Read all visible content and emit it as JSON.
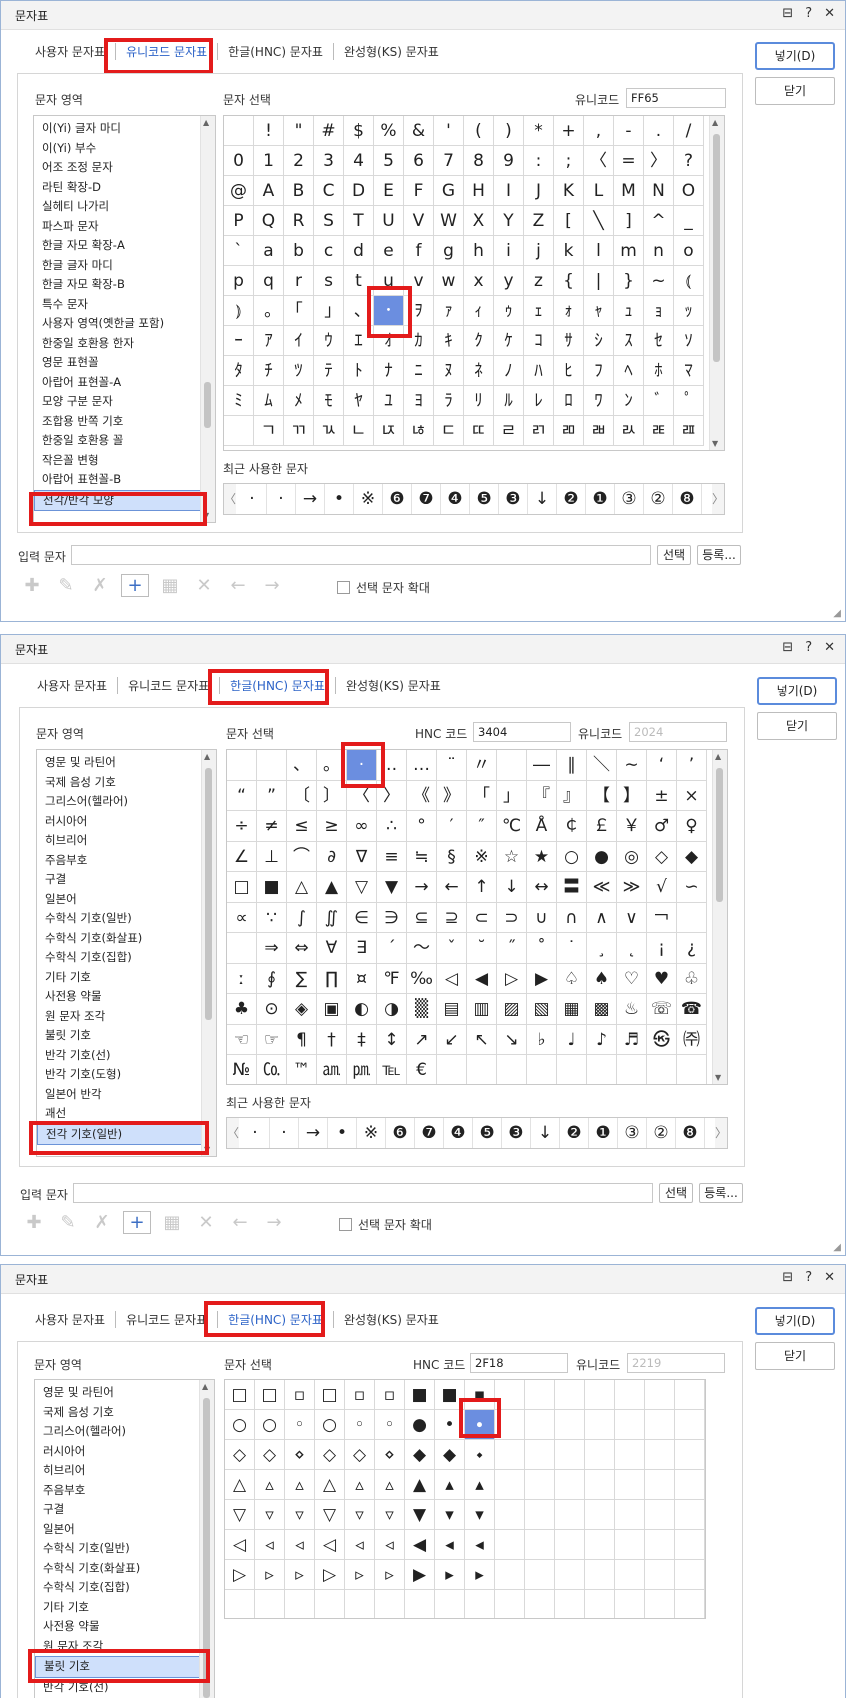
{
  "dialog1": {
    "title": "문자표",
    "tabs": [
      "사용자 문자표",
      "유니코드 문자표",
      "한글(HNC) 문자표",
      "완성형(KS) 문자표"
    ],
    "active_tab": 1,
    "area_label": "문자 영역",
    "select_label": "문자 선택",
    "code_label": "유니코드",
    "code_value": "FF65",
    "list": [
      "이(Yi) 글자 마디",
      "이(Yi) 부수",
      "어조 조정 문자",
      "라틴 확장-D",
      "실헤티 나가리",
      "파스파 문자",
      "한글 자모 확장-A",
      "한글 글자 마디",
      "한글 자모 확장-B",
      "특수 문자",
      "사용자 영역(옛한글 포함)",
      "한중일 호환용 한자",
      "영문 표현꼴",
      "아랍어 표현꼴-A",
      "모양 구분 문자",
      "조합용 반쪽 기호",
      "한중일 호환용 꼴",
      "작은꼴 변형",
      "아랍어 표현꼴-B",
      "전각/반각 모양"
    ],
    "list_selected": 19,
    "grid": [
      [
        "",
        "!",
        "\"",
        "#",
        "$",
        "%",
        "&",
        "'",
        "(",
        ")",
        "*",
        "+",
        ",",
        "-",
        ".",
        "/"
      ],
      [
        "0",
        "1",
        "2",
        "3",
        "4",
        "5",
        "6",
        "7",
        "8",
        "9",
        ":",
        ";",
        "〈",
        "=",
        "〉",
        "?"
      ],
      [
        "@",
        "A",
        "B",
        "C",
        "D",
        "E",
        "F",
        "G",
        "H",
        "I",
        "J",
        "K",
        "L",
        "M",
        "N",
        "O"
      ],
      [
        "P",
        "Q",
        "R",
        "S",
        "T",
        "U",
        "V",
        "W",
        "X",
        "Y",
        "Z",
        "[",
        "╲",
        "]",
        "^",
        "_"
      ],
      [
        "`",
        "a",
        "b",
        "c",
        "d",
        "e",
        "f",
        "g",
        "h",
        "i",
        "j",
        "k",
        "l",
        "m",
        "n",
        "o"
      ],
      [
        "p",
        "q",
        "r",
        "s",
        "t",
        "u",
        "v",
        "w",
        "x",
        "y",
        "z",
        "{",
        "|",
        "}",
        "~",
        "⦅"
      ],
      [
        "⦆",
        "｡",
        "｢",
        "｣",
        "､",
        "･",
        "ｦ",
        "ｧ",
        "ｨ",
        "ｩ",
        "ｪ",
        "ｫ",
        "ｬ",
        "ｭ",
        "ｮ",
        "ｯ"
      ],
      [
        "ｰ",
        "ｱ",
        "ｲ",
        "ｳ",
        "ｴ",
        "ｵ",
        "ｶ",
        "ｷ",
        "ｸ",
        "ｹ",
        "ｺ",
        "ｻ",
        "ｼ",
        "ｽ",
        "ｾ",
        "ｿ"
      ],
      [
        "ﾀ",
        "ﾁ",
        "ﾂ",
        "ﾃ",
        "ﾄ",
        "ﾅ",
        "ﾆ",
        "ﾇ",
        "ﾈ",
        "ﾉ",
        "ﾊ",
        "ﾋ",
        "ﾌ",
        "ﾍ",
        "ﾎ",
        "ﾏ"
      ],
      [
        "ﾐ",
        "ﾑ",
        "ﾒ",
        "ﾓ",
        "ﾔ",
        "ﾕ",
        "ﾖ",
        "ﾗ",
        "ﾘ",
        "ﾙ",
        "ﾚ",
        "ﾛ",
        "ﾜ",
        "ﾝ",
        "ﾞ",
        "ﾟ"
      ],
      [
        "",
        "ﾡ",
        "ﾢ",
        "ﾣ",
        "ﾤ",
        "ﾥ",
        "ﾦ",
        "ﾧ",
        "ﾨ",
        "ﾩ",
        "ﾪ",
        "ﾫ",
        "ﾬ",
        "ﾭ",
        "ﾮ",
        "ﾯ"
      ]
    ],
    "selected_cell": [
      6,
      5
    ],
    "recent_label": "최근 사용한 문자",
    "recent": [
      "·",
      "·",
      "→",
      "•",
      "※",
      "❻",
      "❼",
      "❹",
      "❺",
      "❸",
      "↓",
      "❷",
      "❶",
      "③",
      "②",
      "❽"
    ],
    "input_label": "입력 문자",
    "input_value": "",
    "select_btn": "선택",
    "register_btn": "등록...",
    "enlarge_label": "선택 문자 확대",
    "insert_btn": "넣기(D)",
    "close_btn": "닫기"
  },
  "dialog2": {
    "title": "문자표",
    "tabs": [
      "사용자 문자표",
      "유니코드 문자표",
      "한글(HNC) 문자표",
      "완성형(KS) 문자표"
    ],
    "active_tab": 2,
    "area_label": "문자 영역",
    "select_label": "문자 선택",
    "hnc_label": "HNC 코드",
    "hnc_value": "3404",
    "code_label": "유니코드",
    "code_value": "2024",
    "list": [
      "영문 및 라틴어",
      "국제 음성 기호",
      "그리스어(헬라어)",
      "러시아어",
      "히브리어",
      "주음부호",
      "구결",
      "일본어",
      "수학식 기호(일반)",
      "수학식 기호(화살표)",
      "수학식 기호(집합)",
      "기타 기호",
      "사전용 약물",
      "원 문자 조각",
      "불릿 기호",
      "반각 기호(선)",
      "반각 기호(도형)",
      "일본어 반각",
      "괘선",
      "전각 기호(일반)"
    ],
    "list_selected": 19,
    "grid": [
      [
        "",
        "",
        "、",
        "。",
        "·",
        "‥",
        "…",
        "¨",
        "〃",
        "­",
        "―",
        "∥",
        "＼",
        "∼",
        "‘",
        "’"
      ],
      [
        "“",
        "”",
        "〔",
        "〕",
        "〈",
        "〉",
        "《",
        "》",
        "「",
        "」",
        "『",
        "』",
        "【",
        "】",
        "±",
        "×"
      ],
      [
        "÷",
        "≠",
        "≤",
        "≥",
        "∞",
        "∴",
        "°",
        "′",
        "″",
        "℃",
        "Å",
        "￠",
        "￡",
        "￥",
        "♂",
        "♀"
      ],
      [
        "∠",
        "⊥",
        "⌒",
        "∂",
        "∇",
        "≡",
        "≒",
        "§",
        "※",
        "☆",
        "★",
        "○",
        "●",
        "◎",
        "◇",
        "◆"
      ],
      [
        "□",
        "■",
        "△",
        "▲",
        "▽",
        "▼",
        "→",
        "←",
        "↑",
        "↓",
        "↔",
        "〓",
        "≪",
        "≫",
        "√",
        "∽"
      ],
      [
        "∝",
        "∵",
        "∫",
        "∬",
        "∈",
        "∋",
        "⊆",
        "⊇",
        "⊂",
        "⊃",
        "∪",
        "∩",
        "∧",
        "∨",
        "￢",
        ""
      ],
      [
        "",
        "⇒",
        "⇔",
        "∀",
        "∃",
        "´",
        "～",
        "ˇ",
        "˘",
        "˝",
        "˚",
        "˙",
        "¸",
        "˛",
        "¡",
        "¿"
      ],
      [
        "ː",
        "∮",
        "∑",
        "∏",
        "¤",
        "℉",
        "‰",
        "◁",
        "◀",
        "▷",
        "▶",
        "♤",
        "♠",
        "♡",
        "♥",
        "♧"
      ],
      [
        "♣",
        "⊙",
        "◈",
        "▣",
        "◐",
        "◑",
        "▒",
        "▤",
        "▥",
        "▨",
        "▧",
        "▦",
        "▩",
        "♨",
        "☏",
        "☎"
      ],
      [
        "☜",
        "☞",
        "¶",
        "†",
        "‡",
        "↕",
        "↗",
        "↙",
        "↖",
        "↘",
        "♭",
        "♩",
        "♪",
        "♬",
        "㉿",
        "㈜"
      ],
      [
        "№",
        "㏇",
        "™",
        "㏂",
        "㏘",
        "℡",
        "€",
        "",
        "",
        "",
        "",
        "",
        "",
        "",
        "",
        ""
      ]
    ],
    "selected_cell": [
      0,
      4
    ],
    "recent_label": "최근 사용한 문자",
    "recent": [
      "·",
      "·",
      "→",
      "•",
      "※",
      "❻",
      "❼",
      "❹",
      "❺",
      "❸",
      "↓",
      "❷",
      "❶",
      "③",
      "②",
      "❽"
    ],
    "input_label": "입력 문자",
    "input_value": "",
    "select_btn": "선택",
    "register_btn": "등록...",
    "enlarge_label": "선택 문자 확대",
    "insert_btn": "넣기(D)",
    "close_btn": "닫기"
  },
  "dialog3": {
    "title": "문자표",
    "tabs": [
      "사용자 문자표",
      "유니코드 문자표",
      "한글(HNC) 문자표",
      "완성형(KS) 문자표"
    ],
    "active_tab": 2,
    "area_label": "문자 영역",
    "select_label": "문자 선택",
    "hnc_label": "HNC 코드",
    "hnc_value": "2F18",
    "code_label": "유니코드",
    "code_value": "2219",
    "list": [
      "영문 및 라틴어",
      "국제 음성 기호",
      "그리스어(헬라어)",
      "러시아어",
      "히브리어",
      "주음부호",
      "구결",
      "일본어",
      "수학식 기호(일반)",
      "수학식 기호(화살표)",
      "수학식 기호(집합)",
      "기타 기호",
      "사전용 약물",
      "원 문자 조각",
      "불릿 기호",
      "반각 기호(선)"
    ],
    "list_selected": 14,
    "grid": [
      [
        "□",
        "□",
        "▫",
        "□",
        "▫",
        "▫",
        "■",
        "■",
        "▪",
        "",
        "",
        "",
        "",
        "",
        "",
        ""
      ],
      [
        "○",
        "○",
        "◦",
        "○",
        "◦",
        "◦",
        "●",
        "•",
        "∙",
        "",
        "",
        "",
        "",
        "",
        "",
        ""
      ],
      [
        "◇",
        "◇",
        "⋄",
        "◇",
        "◇",
        "⋄",
        "◆",
        "◆",
        "⬩",
        "",
        "",
        "",
        "",
        "",
        "",
        ""
      ],
      [
        "△",
        "▵",
        "▵",
        "△",
        "▵",
        "▵",
        "▲",
        "▴",
        "▴",
        "",
        "",
        "",
        "",
        "",
        "",
        ""
      ],
      [
        "▽",
        "▿",
        "▿",
        "▽",
        "▿",
        "▿",
        "▼",
        "▾",
        "▾",
        "",
        "",
        "",
        "",
        "",
        "",
        ""
      ],
      [
        "◁",
        "◃",
        "◃",
        "◁",
        "◃",
        "◃",
        "◀",
        "◂",
        "◂",
        "",
        "",
        "",
        "",
        "",
        "",
        ""
      ],
      [
        "▷",
        "▹",
        "▹",
        "▷",
        "▹",
        "▹",
        "▶",
        "▸",
        "▸",
        "",
        "",
        "",
        "",
        "",
        "",
        ""
      ],
      [
        "",
        "",
        "",
        "",
        "",
        "",
        "",
        "",
        "",
        "",
        "",
        "",
        "",
        "",
        "",
        ""
      ]
    ],
    "selected_cell": [
      1,
      8
    ],
    "insert_btn": "넣기(D)",
    "close_btn": "닫기"
  },
  "icons": {
    "titlebar": [
      "memo-icon",
      "help-icon",
      "close-icon"
    ],
    "toolbar": [
      "add-char-icon",
      "edit-char-icon",
      "delete-char-icon",
      "add-icon",
      "table-icon",
      "remove-icon",
      "left-arrow-icon",
      "right-arrow-icon"
    ]
  },
  "colors": {
    "accent": "#2b62c7",
    "selection": "#6b8ee0",
    "highlight": "#e31b1b"
  }
}
